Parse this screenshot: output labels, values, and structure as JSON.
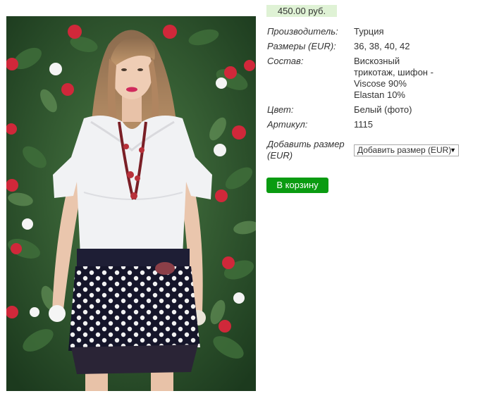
{
  "product": {
    "price": "450.00 руб.",
    "image_alt": "Модель в белой блузке и юбке в горошек",
    "specs": [
      {
        "label": "Производитель:",
        "value": "Турция"
      },
      {
        "label": "Размеры (EUR):",
        "value": "36, 38, 40, 42"
      },
      {
        "label": "Состав:",
        "value": "Вискозный трикотаж, шифон - Viscose 90% Elastan 10%"
      },
      {
        "label": "Цвет:",
        "value": "Белый (фото)"
      },
      {
        "label": "Артикул:",
        "value": "1115"
      }
    ],
    "add_size_label": "Добавить размер (EUR)",
    "size_select_value": "Добавить размер (EUR)",
    "cart_button": "В корзину"
  },
  "colors": {
    "price_bg": "#dff2d5",
    "cart_button_bg": "#0a9b11"
  }
}
